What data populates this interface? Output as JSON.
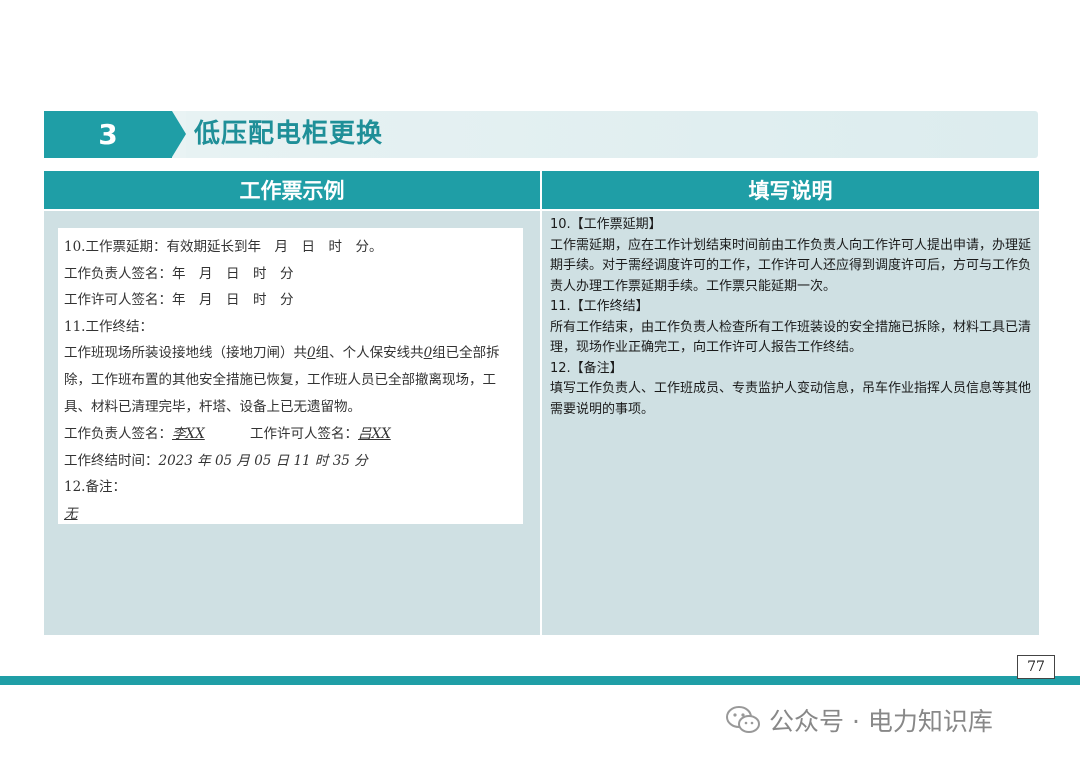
{
  "section": {
    "number": "3",
    "title": "低压配电柜更换"
  },
  "table": {
    "header_left": "工作票示例",
    "header_right": "填写说明"
  },
  "form": {
    "line1": "10.工作票延期：有效期延长到年　月　日　时　分。",
    "line2": "工作负责人签名：年　月　日　时　分",
    "line3": "工作许可人签名：年　月　日　时　分",
    "line4": "11.工作终结：",
    "para_a": "工作班现场所装设接地线（接地刀闸）共",
    "ground_count": "0",
    "para_b": "组、个人保安线共",
    "personal_count": "0",
    "para_c": "组已全部拆除，工作班布置的其他安全措施已恢复，工作班人员已全部撤离现场，工具、材料已清理完毕，杆塔、设备上已无遗留物。",
    "sig_leader_label": "工作负责人签名：",
    "sig_leader_value": "李XX",
    "sig_permit_label": "工作许可人签名：",
    "sig_permit_value": "吕XX",
    "end_time_label": "工作终结时间：",
    "end_time_value": "2023 年 05 月 05 日 11 时 35 分",
    "line_notes": "12.备注：",
    "notes_value": "无"
  },
  "explanation": {
    "h1": "10.【工作票延期】",
    "p1": "工作需延期，应在工作计划结束时间前由工作负责人向工作许可人提出申请，办理延期手续。对于需经调度许可的工作，工作许可人还应得到调度许可后，方可与工作负责人办理工作票延期手续。工作票只能延期一次。",
    "h2": "11.【工作终结】",
    "p2": "所有工作结束，由工作负责人检查所有工作班装设的安全措施已拆除，材料工具已清理，现场作业正确完工，向工作许可人报告工作终结。",
    "h3": "12.【备注】",
    "p3": "填写工作负责人、工作班成员、专责监护人变动信息，吊车作业指挥人员信息等其他需要说明的事项。"
  },
  "page_number": "77",
  "watermark": "公众号 · 电力知识库",
  "colors": {
    "accent": "#1f9ea6",
    "cell_bg": "#cfe0e3"
  }
}
